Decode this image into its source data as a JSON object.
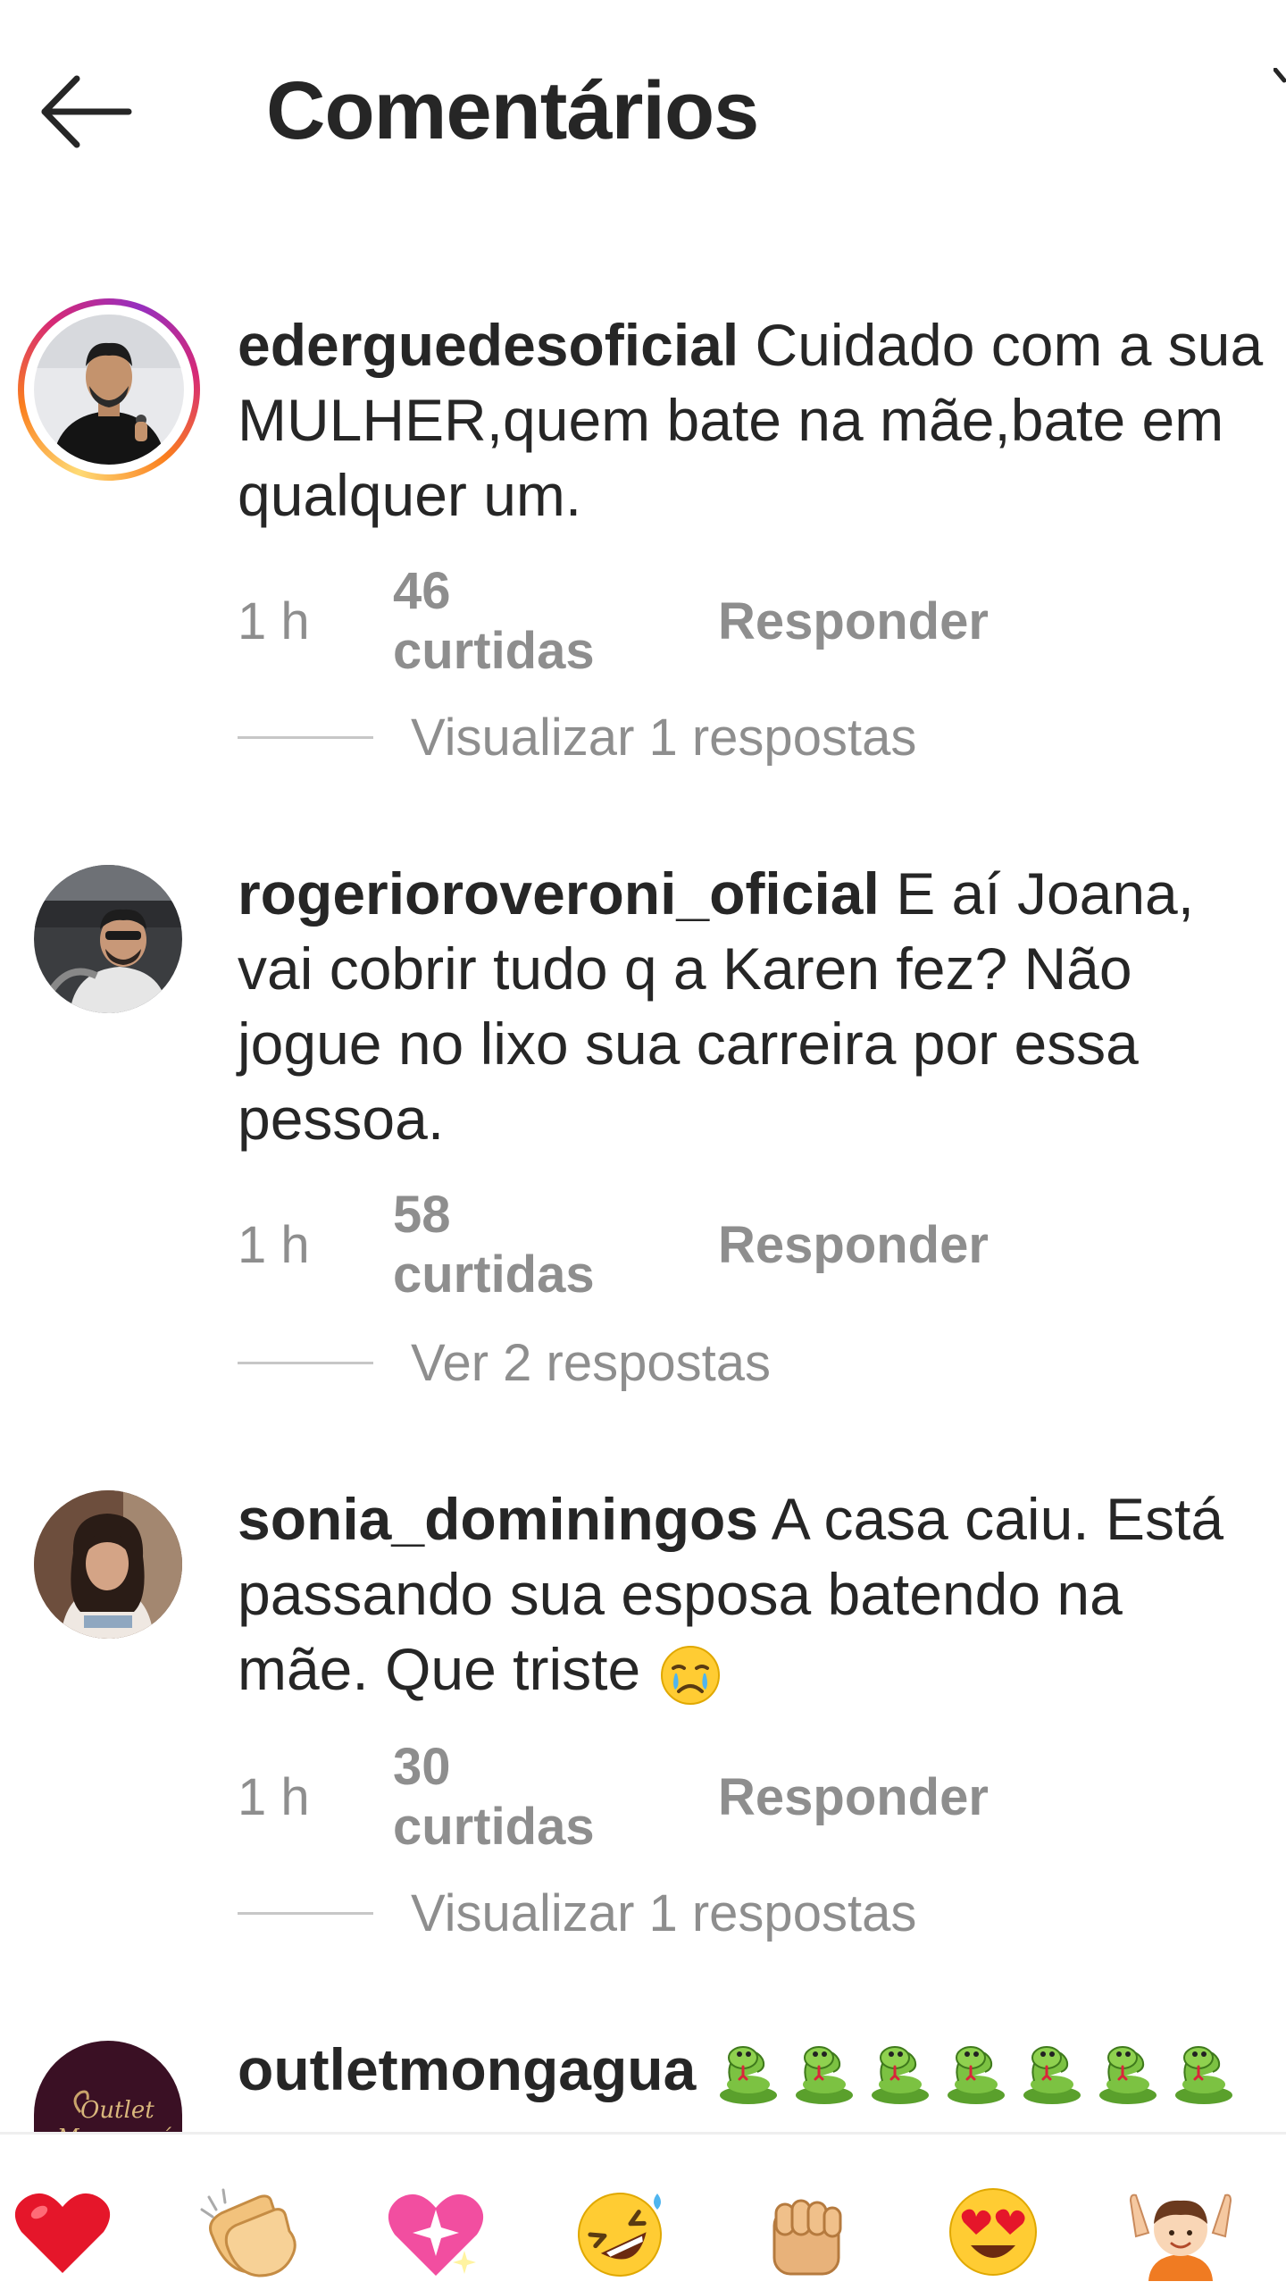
{
  "header": {
    "title": "Comentários",
    "back_icon": "arrow-left-icon"
  },
  "comments": [
    {
      "username": "ederguedesoficial",
      "text": "Cuidado com a sua MULHER,quem bate na mãe,bate em qualquer um.",
      "time": "1 h",
      "likes": "46 curtidas",
      "reply_label": "Responder",
      "view_replies": "Visualizar 1 respostas",
      "has_story": true
    },
    {
      "username": "rogerioroveroni_oficial",
      "text": "E aí Joana, vai cobrir tudo q a Karen fez? Não jogue no lixo sua carreira por essa pessoa.",
      "time": "1 h",
      "likes": "58 curtidas",
      "reply_label": "Responder",
      "view_replies": "Ver 2 respostas",
      "has_story": false
    },
    {
      "username": "sonia_dominingos",
      "text": "A casa caiu. Está passando sua esposa batendo na mãe. Que triste",
      "trailing_emoji": "crying-face-icon",
      "time": "1 h",
      "likes": "30 curtidas",
      "reply_label": "Responder",
      "view_replies": "Visualizar 1 respostas",
      "has_story": false
    },
    {
      "username": "outletmongagua",
      "avatar_text": "Outlet Mongaguá",
      "trailing_emojis": [
        "snake-icon",
        "snake-icon",
        "snake-icon",
        "snake-icon",
        "snake-icon",
        "snake-icon",
        "snake-icon"
      ],
      "has_story": false
    }
  ],
  "emoji_bar": [
    "red-heart-icon",
    "clapping-hands-icon",
    "sparkling-heart-icon",
    "rolling-laughing-icon",
    "fist-icon",
    "heart-eyes-icon",
    "raising-hands-person-icon"
  ],
  "colors": {
    "text": "#262626",
    "secondary": "#8e8e8e",
    "divider": "#c7c7c7"
  }
}
